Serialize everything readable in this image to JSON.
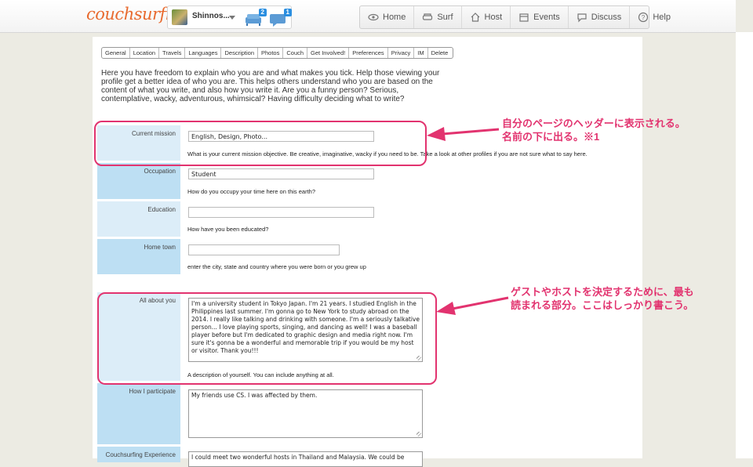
{
  "header": {
    "logo": "couchsurfing",
    "username": "Shinnos...",
    "couch_badge": "2",
    "message_badge": "1",
    "nav": [
      {
        "icon": "eye-icon",
        "label": "Home"
      },
      {
        "icon": "couch-icon",
        "label": "Surf"
      },
      {
        "icon": "house-icon",
        "label": "Host"
      },
      {
        "icon": "calendar-icon",
        "label": "Events"
      },
      {
        "icon": "chat-icon",
        "label": "Discuss"
      },
      {
        "icon": "question-icon",
        "label": "Help"
      }
    ]
  },
  "tabs": [
    "General",
    "Location",
    "Travels",
    "Languages",
    "Description",
    "Photos",
    "Couch",
    "Get Involved!",
    "Preferences",
    "Privacy",
    "IM",
    "Delete"
  ],
  "intro": "Here you have freedom to explain who you are and what makes you tick. Help those viewing your profile get a better idea of who you are. This helps others understand who you are based on the content of what you write, and also how you write it. Are you a funny person? Serious, contemplative, wacky, adventurous, whimsical? Having difficulty deciding what to write?",
  "fields": {
    "current_mission": {
      "label": "Current mission",
      "value": "English, Design, Photo...",
      "hint": "What is your current mission objective. Be creative, imaginative, wacky if you need to be. Take a look at other profiles if you are not sure what to say here."
    },
    "occupation": {
      "label": "Occupation",
      "value": "Student",
      "hint": "How do you occupy your time here on this earth?"
    },
    "education": {
      "label": "Education",
      "value": "",
      "hint": "How have you been educated?"
    },
    "home_town": {
      "label": "Home town",
      "value": "",
      "hint": "enter the city, state and country where you were born or you grew up"
    },
    "all_about_you": {
      "label": "All about you",
      "value": "I'm a university student in Tokyo Japan. I'm 21 years. I studied English in the Philippines last summer. I'm gonna go to New York to study abroad on the 2014. I really like talking and drinking with someone. I'm a seriously talkative person... I love playing sports, singing, and dancing as well! I was a baseball player before but I'm dedicated to graphic design and media right now. I'm sure it's gonna be a wonderful and memorable trip if you would be my host or visitor. Thank you!!!",
      "hint": "A description of yourself. You can include anything at all."
    },
    "how_i_participate": {
      "label": "How I participate",
      "value": "My friends use CS. I was affected by them."
    },
    "cs_experience": {
      "label": "Couchsurfing Experience",
      "value": "I could meet two wonderful hosts in Thailand and Malaysia. We could be"
    }
  },
  "annotations": {
    "note1_line1": "自分のページのヘッダーに表示される。",
    "note1_line2": "名前の下に出る。※1",
    "note2_line1": "ゲストやホストを決定するために、最も",
    "note2_line2": "読まれる部分。ここはしっかり書こう。",
    "color": "#e2336f"
  }
}
